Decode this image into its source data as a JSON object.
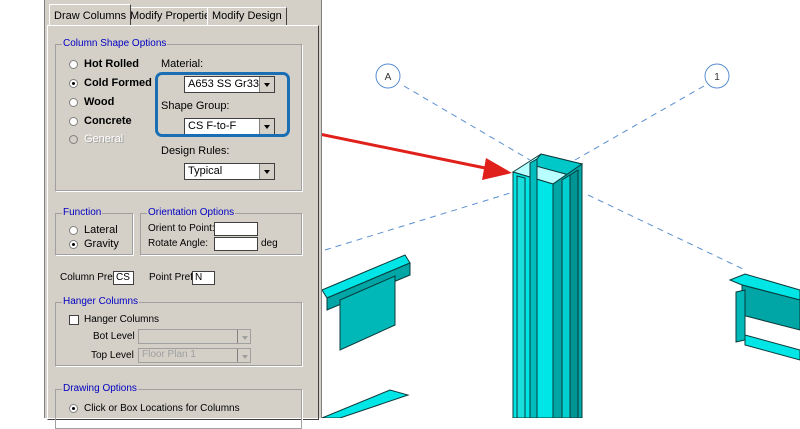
{
  "tabs": [
    "Draw Columns",
    "Modify Properties",
    "Modify Design"
  ],
  "shape_options": {
    "legend": "Column Shape Options",
    "radios": [
      {
        "label": "Hot Rolled",
        "selected": false,
        "enabled": true
      },
      {
        "label": "Cold Formed",
        "selected": true,
        "enabled": true
      },
      {
        "label": "Wood",
        "selected": false,
        "enabled": true
      },
      {
        "label": "Concrete",
        "selected": false,
        "enabled": true
      },
      {
        "label": "General",
        "selected": false,
        "enabled": false
      }
    ],
    "material_label": "Material:",
    "material_value": "A653 SS Gr33",
    "shape_group_label": "Shape Group:",
    "shape_group_value": "CS F-to-F",
    "design_rules_label": "Design Rules:",
    "design_rules_value": "Typical"
  },
  "function": {
    "legend": "Function",
    "radios": [
      {
        "label": "Lateral",
        "selected": false
      },
      {
        "label": "Gravity",
        "selected": true
      }
    ]
  },
  "orientation": {
    "legend": "Orientation Options",
    "orient_label": "Orient to Point:",
    "orient_value": "",
    "rotate_label": "Rotate Angle:",
    "rotate_value": "",
    "rotate_unit": "deg"
  },
  "prefixes": {
    "column_label": "Column Prefix",
    "column_value": "CS",
    "point_label": "Point Prefix",
    "point_value": "N"
  },
  "hanger": {
    "legend": "Hanger Columns",
    "checkbox_label": "Hanger Columns",
    "checked": false,
    "bot_label": "Bot Level",
    "bot_value": "",
    "top_label": "Top Level",
    "top_value": "Floor Plan 1"
  },
  "drawing": {
    "legend": "Drawing Options",
    "option_label": "Click or Box Locations for Columns",
    "selected": true
  },
  "grid_bubbles": [
    "A",
    "1"
  ],
  "colors": {
    "panel": "#d4d0c8",
    "legend_text": "#0000c0",
    "highlight": "#1a6fb4",
    "arrow": "#e0201a",
    "steel_front": "#00e5e5",
    "steel_side": "#00a6a6",
    "grid_line": "#5a8fd0"
  }
}
